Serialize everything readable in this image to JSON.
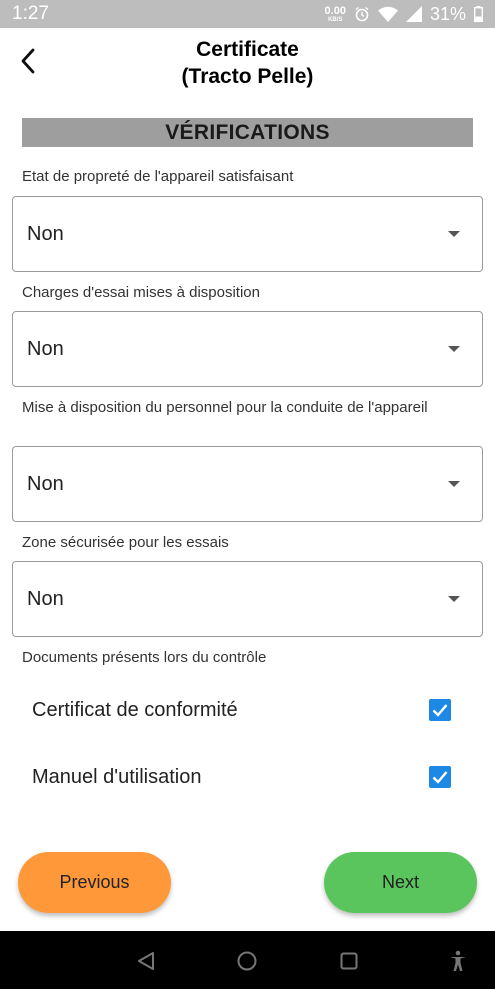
{
  "status_bar": {
    "time": "1:27",
    "net_speed_value": "0.00",
    "net_speed_unit": "KB/S",
    "battery": "31%",
    "icons": [
      "alarm-icon",
      "wifi-icon",
      "signal-icon",
      "battery-icon"
    ]
  },
  "header": {
    "title_line1": "Certificate",
    "title_line2": "(Tracto Pelle)",
    "back_icon": "back-arrow-icon"
  },
  "section": {
    "title": "VÉRIFICATIONS"
  },
  "fields": [
    {
      "label": "Etat de propreté de l'appareil satisfaisant",
      "value": "Non"
    },
    {
      "label": "Charges d'essai mises à disposition",
      "value": "Non"
    },
    {
      "label": "Mise à disposition du personnel pour la conduite de l'appareil",
      "value": "Non"
    },
    {
      "label": "Zone sécurisée pour les essais",
      "value": "Non"
    }
  ],
  "documents": {
    "label": "Documents présents lors du contrôle",
    "items": [
      {
        "label": "Certificat de conformité",
        "checked": true
      },
      {
        "label": "Manuel d'utilisation",
        "checked": true
      }
    ]
  },
  "buttons": {
    "previous": "Previous",
    "next": "Next"
  },
  "colors": {
    "previous_button": "#ff9838",
    "next_button": "#5ac55c",
    "checkbox": "#1e88e5",
    "section_bar": "#9e9e9e",
    "status_bar": "#bdbdbd"
  }
}
